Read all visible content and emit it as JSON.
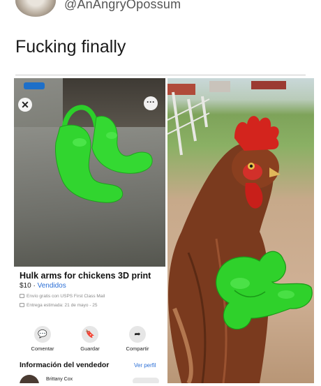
{
  "tweet": {
    "handle": "@AnAngryOpossum",
    "text": "Fucking finally"
  },
  "listing": {
    "close_icon": "close-icon",
    "more_icon": "more-options-icon",
    "title": "Hulk arms for chickens 3D print",
    "price": "$10",
    "separator": " · ",
    "status": "Vendidos",
    "shipping": "Envío gratis con USPS First Class Mail",
    "delivery": "Entrega estimada: 21 de mayo - 25",
    "actions": [
      {
        "label": "Comentar",
        "icon": "comment-icon"
      },
      {
        "label": "Guardar",
        "icon": "bookmark-icon"
      },
      {
        "label": "Compartir",
        "icon": "share-icon"
      }
    ],
    "seller_section_title": "Información del vendedor",
    "seller_link": "Ver perfil",
    "seller_name": "Brittany Cox"
  },
  "colors": {
    "accent_blue": "#2b6fd6",
    "hulk_green": "#2fd12b",
    "comb_red": "#d3241d",
    "hen_brown": "#7a3a1e"
  }
}
